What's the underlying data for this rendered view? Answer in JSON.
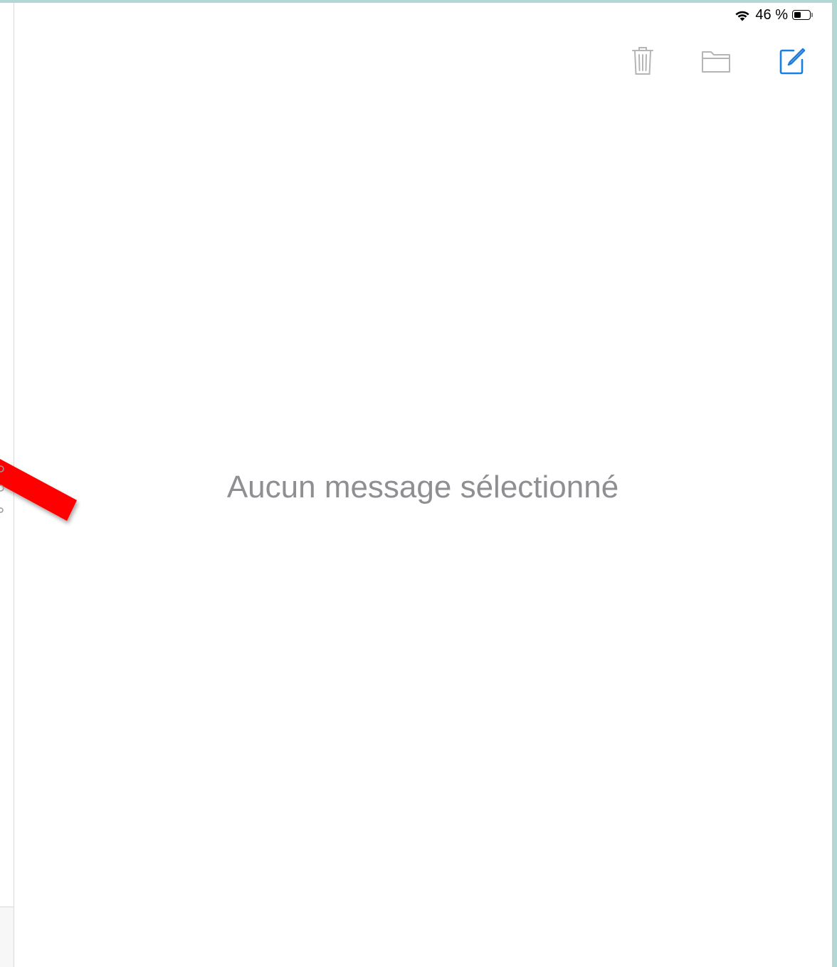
{
  "status_bar": {
    "wifi_icon": "wifi-icon",
    "battery_percent": "46 %",
    "battery_level": 0.46
  },
  "toolbar": {
    "trash_icon": "trash-icon",
    "folder_icon": "folder-icon",
    "compose_icon": "compose-icon",
    "disabled_color": "#b5b5b5",
    "accent_color": "#1a7fe3"
  },
  "detail": {
    "empty_message": "Aucun message sélectionné"
  },
  "annotation": {
    "arrow_color": "#ff0000"
  }
}
